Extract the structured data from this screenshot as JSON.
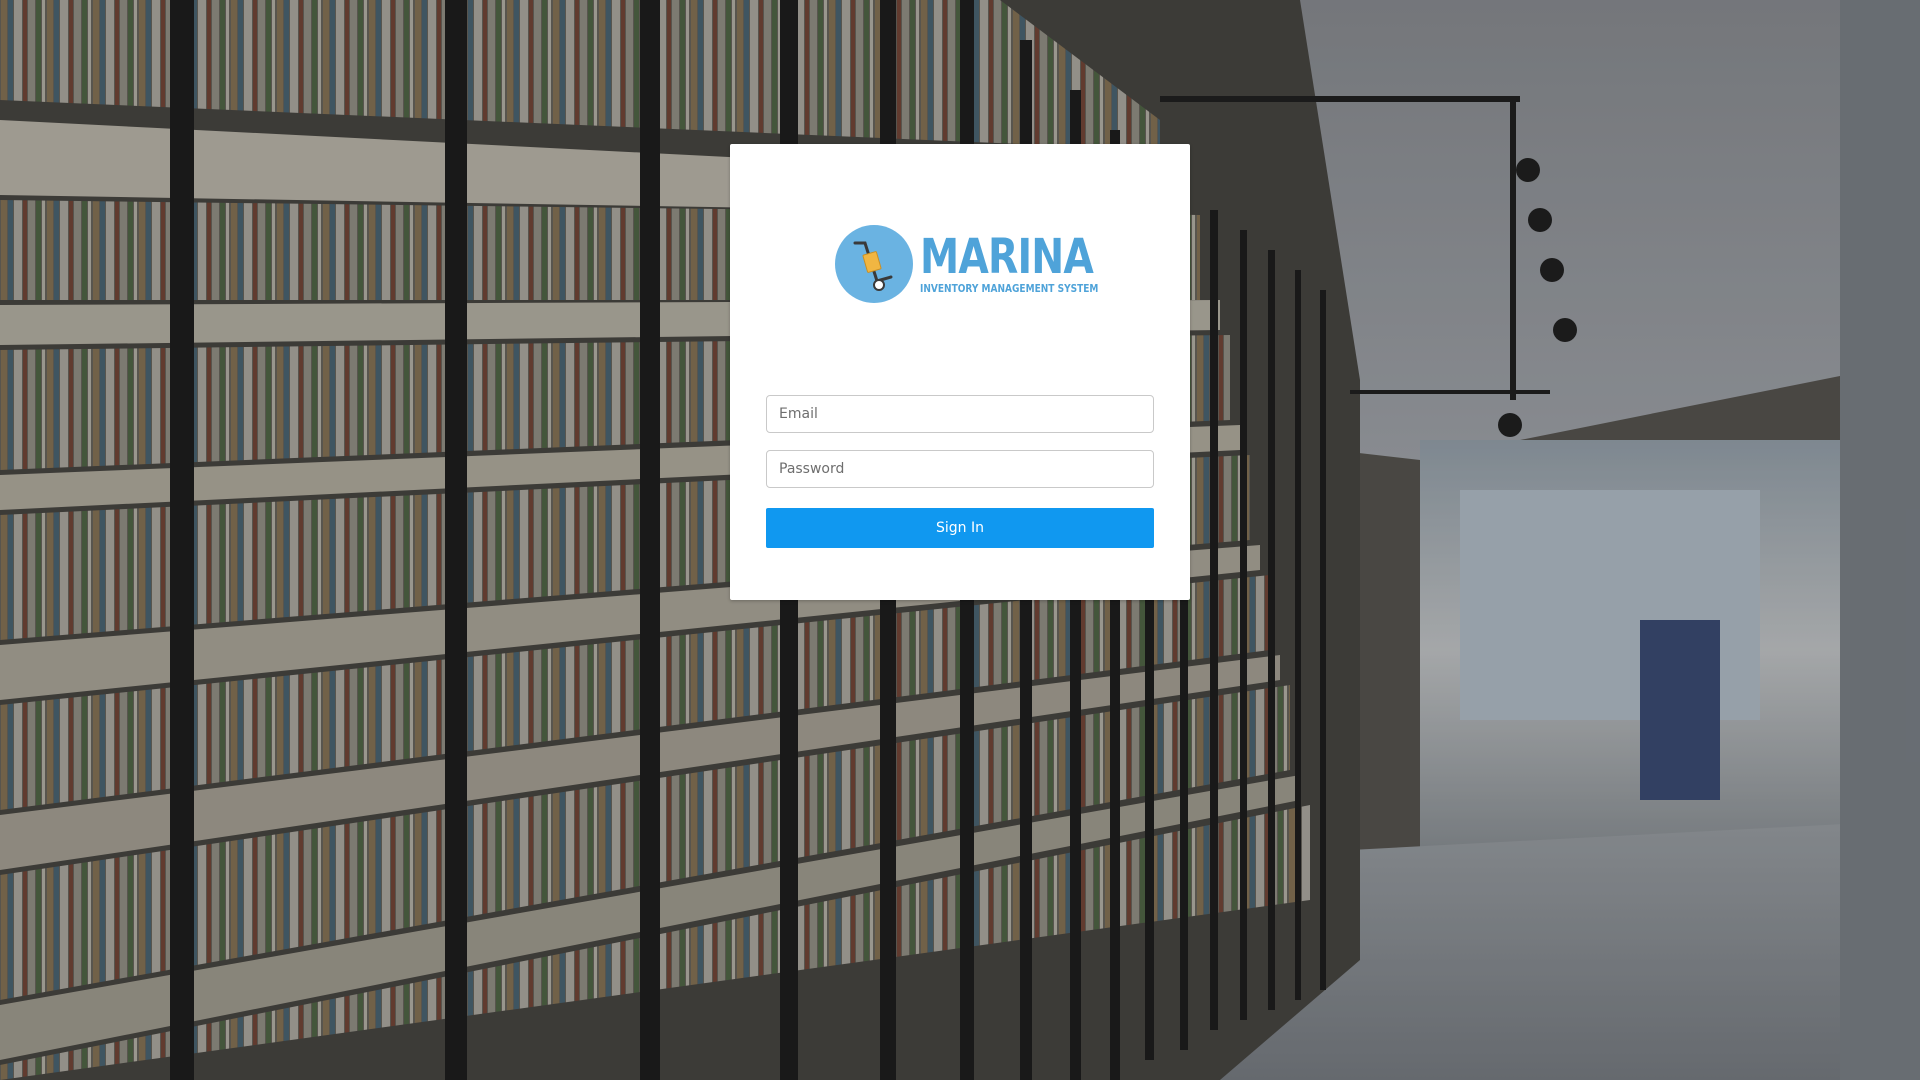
{
  "brand": {
    "name": "MARINA",
    "tagline": "INVENTORY MANAGEMENT SYSTEM",
    "color": "#4fa3d9"
  },
  "login": {
    "email_placeholder": "Email",
    "password_placeholder": "Password",
    "submit_label": "Sign In",
    "submit_color": "#1098f0"
  },
  "icons": {
    "logo": "hand-truck-icon"
  }
}
